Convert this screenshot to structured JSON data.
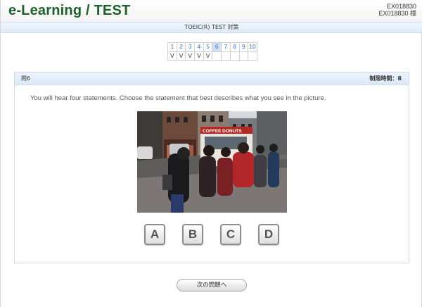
{
  "header": {
    "logo": "e-Learning / TEST",
    "user_id": "EX018830",
    "user_name": "EX018830 様"
  },
  "subheader": {
    "title": "TOEIC(R) TEST 対策"
  },
  "progress": {
    "numbers": [
      "1",
      "2",
      "3",
      "4",
      "5",
      "6",
      "7",
      "8",
      "9",
      "10"
    ],
    "marks": [
      "V",
      "V",
      "V",
      "V",
      "V",
      "",
      "",
      "",
      "",
      ""
    ],
    "current": 6
  },
  "question": {
    "number_label": "問6",
    "time_limit": "制限時間：8",
    "instruction": "You will hear four statements. Choose the statement that best describes what you see in the picture.",
    "photo_sign": "COFFEE DONUTS"
  },
  "choices": [
    "A",
    "B",
    "C",
    "D"
  ],
  "next_button": "次の問題へ",
  "colors": {
    "logo_green": "#1f5f2b",
    "link_blue": "#3b6fc2",
    "panel_header": "#dce8f8"
  }
}
